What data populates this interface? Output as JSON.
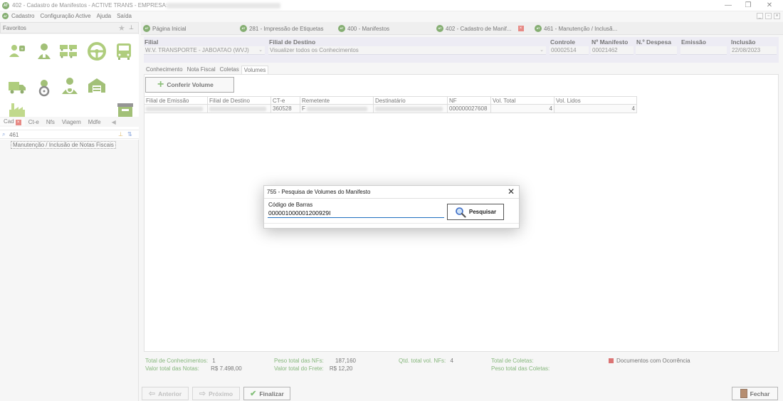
{
  "window": {
    "title": "402 - Cadastro de Manifestos - ACTIVE TRANS - EMPRESA:",
    "app_icon": "AT",
    "controls": [
      "—",
      "❐",
      "✕"
    ]
  },
  "menubar": {
    "items": [
      "Cadastro",
      "Configuração Active",
      "Ajuda",
      "Saída"
    ],
    "mdi_controls": [
      "_",
      "▫",
      "×"
    ]
  },
  "sidebar": {
    "favorites_label": "Favoritos",
    "icons": [
      "person-add-icon",
      "person-icon",
      "truck-fleet-icon",
      "steering-wheel-icon",
      "bus-icon",
      "delivery-truck-icon",
      "driver-icon",
      "driver-person-icon",
      "warehouse-icon",
      "factory-icon",
      "archive-box-icon"
    ],
    "tabs": [
      "Cad",
      "Ct-e",
      "Nfs",
      "Viagem",
      "Mdfe"
    ],
    "search_value": "461",
    "result": "Manutenção / Inclusão de Notas Fiscais"
  },
  "doc_tabs": [
    {
      "label": "Página Inicial",
      "closable": false
    },
    {
      "label": "281 - Impressão de Etiquetas",
      "closable": false
    },
    {
      "label": "400 - Manifestos",
      "closable": false
    },
    {
      "label": "402 - Cadastro de Manif...",
      "closable": true
    },
    {
      "label": "461 - Manutenção / Inclusã...",
      "closable": false
    }
  ],
  "form_header": {
    "filial_label": "Filial",
    "filial_value": "W.V. TRANSPORTE - JABOATAO (WVJ)",
    "destino_label": "Filial de Destino",
    "destino_value": "Visualizer todos os Conhecimentos",
    "controle_label": "Controle",
    "controle_value": "00002514",
    "manifesto_label": "Nº Manifesto",
    "manifesto_value": "00021462",
    "despesa_label": "N.º Despesa",
    "despesa_value": "",
    "emissao_label": "Emissão",
    "emissao_value": "",
    "inclusao_label": "Inclusão",
    "inclusao_value": "22/08/2023"
  },
  "content_tabs": [
    "Conhecimento",
    "Nota Fiscal",
    "Coletas",
    "Volumes"
  ],
  "conferir_label": "Conferir Volume",
  "grid": {
    "columns": [
      "Filial de Emissão",
      "Filial de Destino",
      "CT-e",
      "Remetente",
      "Destinatário",
      "NF",
      "Vol. Total",
      "Vol. Lidos"
    ],
    "rows": [
      {
        "filial_emissao": "",
        "filial_destino": "",
        "cte": "360528",
        "remetente": "F",
        "destinatario": "",
        "nf": "000000027608",
        "vol_total": "4",
        "vol_lidos": "4"
      }
    ]
  },
  "dialog": {
    "title": "755 - Pesquisa de Volumes do Manifesto",
    "close_glyph": "✕",
    "barcode_label": "Código de Barras",
    "barcode_value": "000001000001200929I",
    "search_button": "Pesquisar"
  },
  "totals": {
    "conhecimentos_label": "Total de Conhecimentos:",
    "conhecimentos_value": "1",
    "valor_notas_label": "Valor total das Notas:",
    "valor_notas_value": "R$ 7.498,00",
    "peso_nfs_label": "Peso total das NFs:",
    "peso_nfs_value": "187,160",
    "valor_frete_label": "Valor total do Frete:",
    "valor_frete_value": "R$ 12,20",
    "qtd_vol_label": "Qtd. total vol. NFs:",
    "qtd_vol_value": "4",
    "total_coletas_label": "Total de Coletas:",
    "peso_coletas_label": "Peso total das Coletas:",
    "ocorrencia_label": "Documentos com Ocorrência"
  },
  "buttons": {
    "anterior": "Anterior",
    "proximo": "Próximo",
    "finalizar": "Finalizar",
    "fechar": "Fechar"
  },
  "colors": {
    "accent_green": "#4a9a2e",
    "header_band": "#e2e1ee",
    "input_underline": "#1f6fbf",
    "occurrence_red": "#c51f1f"
  }
}
